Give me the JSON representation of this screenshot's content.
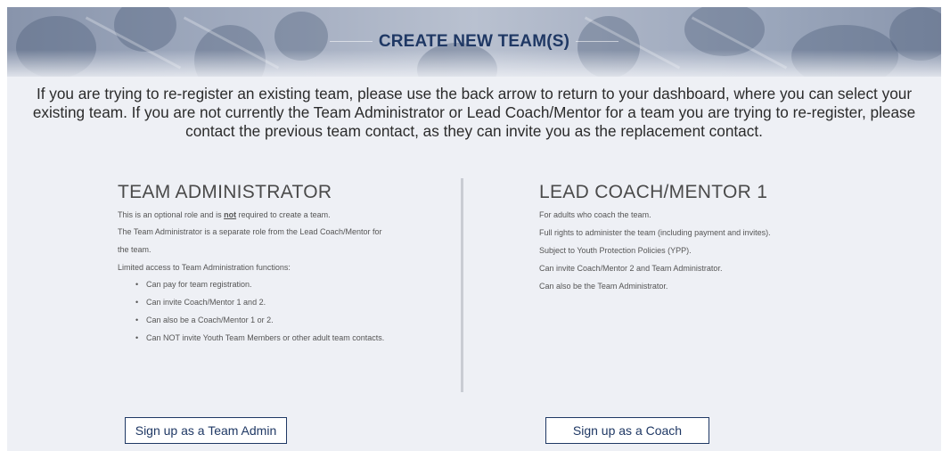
{
  "banner": {
    "title": "CREATE NEW TEAM(S)"
  },
  "intro": "If you are trying to re-register an existing team, please use the back arrow to return to your dashboard, where you can select your existing team. If you are not currently the Team Administrator or Lead Coach/Mentor for a team you are trying to re-register, please contact the previous team contact, as they can invite you as the replacement contact.",
  "admin": {
    "heading": "TEAM ADMINISTRATOR",
    "optional_pre": "This is an optional role and is ",
    "optional_emph": "not",
    "optional_post": " required to create a team.",
    "separate": "The Team Administrator is a separate role from the Lead Coach/Mentor for",
    "separate_cont": "the team.",
    "limited": "Limited access to Team Administration functions:",
    "bullets": [
      "Can pay for team registration.",
      "Can invite Coach/Mentor 1 and 2.",
      "Can also be a Coach/Mentor 1 or 2.",
      "Can NOT invite Youth Team Members or other adult team contacts."
    ],
    "button_label": "Sign up as a Team Admin"
  },
  "coach": {
    "heading": "LEAD COACH/MENTOR 1",
    "lines": [
      "For adults who coach the team.",
      "Full rights to administer the team (including payment and invites).",
      "Subject to Youth Protection Policies (YPP).",
      "Can invite Coach/Mentor 2 and Team Administrator.",
      "Can also be the Team Administrator."
    ],
    "button_label": "Sign up as a Coach"
  },
  "colors": {
    "title": "#1f3864",
    "button_border": "#1f3864",
    "background": "#eef0f5"
  }
}
